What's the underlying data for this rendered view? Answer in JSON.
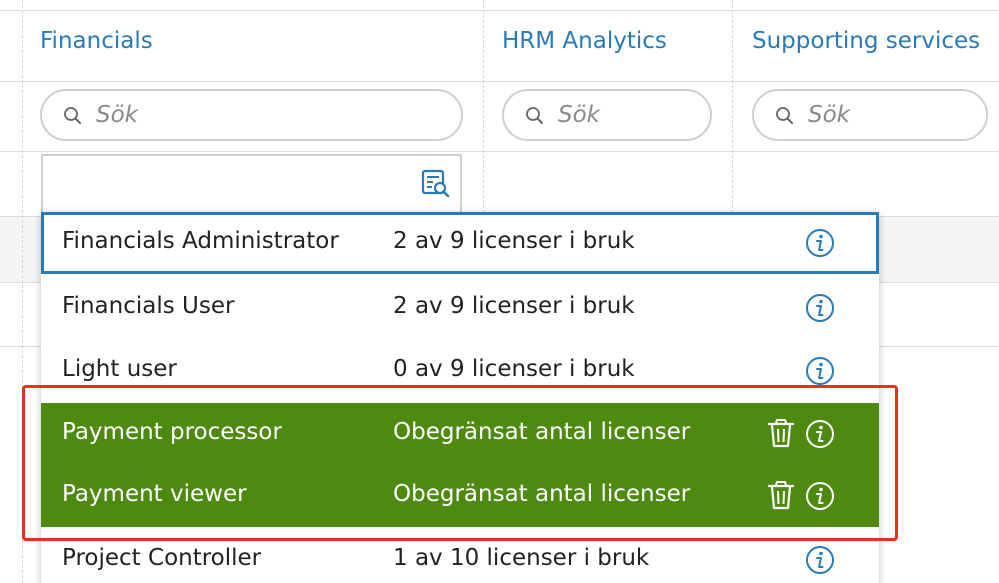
{
  "columns": [
    {
      "header": "Financials",
      "search_placeholder": "Sök"
    },
    {
      "header": "HRM Analytics",
      "search_placeholder": "Sök"
    },
    {
      "header": "Supporting services",
      "search_placeholder": "Sök"
    }
  ],
  "dropdown": {
    "options": [
      {
        "name": "Financials Administrator",
        "licenses": "2 av 9 licenser i bruk"
      },
      {
        "name": "Financials User",
        "licenses": "2 av 9 licenser i bruk"
      },
      {
        "name": "Light user",
        "licenses": "0 av 9 licenser i bruk"
      },
      {
        "name": "Payment processor",
        "licenses": "Obegränsat antal licenser"
      },
      {
        "name": "Payment viewer",
        "licenses": "Obegränsat antal licenser"
      },
      {
        "name": "Project Controller",
        "licenses": "1 av 10 licenser i bruk"
      }
    ]
  },
  "colors": {
    "accent": "#2a7ab8",
    "selected_green": "#4e8a0f",
    "annotation_red": "#e8301c"
  },
  "icons": {
    "search": "magnifier-icon",
    "filter": "list-search-icon",
    "info": "info-circle-icon",
    "delete": "trash-icon"
  }
}
